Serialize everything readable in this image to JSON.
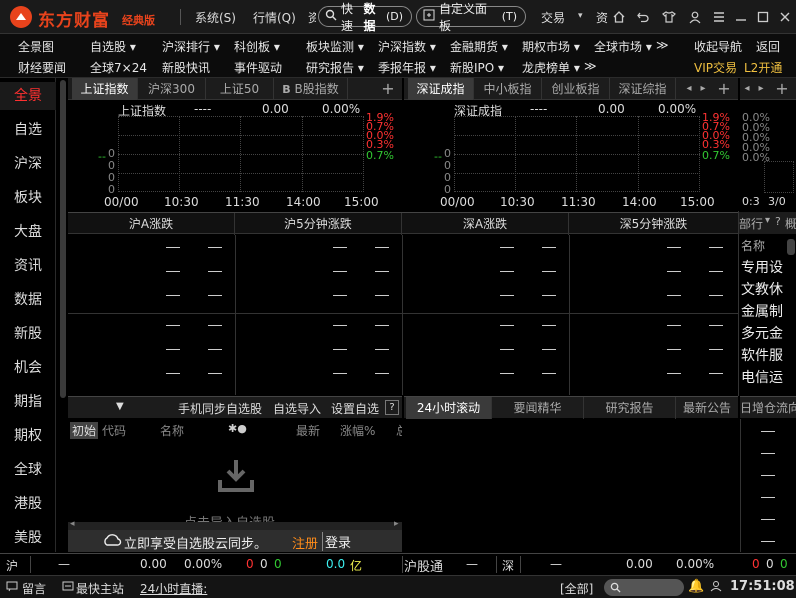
{
  "app": {
    "title": "东方财富",
    "edition": "经典版"
  },
  "topmenu": [
    "系统(S)",
    "行情(Q)",
    "交易",
    "资"
  ],
  "search_pill": {
    "prefix": "快速",
    "bold": "数据",
    "hotkey": "(D)"
  },
  "custom_pill": {
    "label": "自定义面板",
    "hotkey": "(T)"
  },
  "menu_row1": [
    "全景图",
    "自选股 ▾",
    "沪深排行 ▾",
    "科创板 ▾",
    "板块监测 ▾",
    "沪深指数 ▾",
    "金融期货 ▾",
    "期权市场 ▾",
    "全球市场 ▾",
    "≫",
    "收起导航",
    "返回"
  ],
  "menu_row2": [
    "财经要闻",
    "全球7×24",
    "新股快讯",
    "事件驱动",
    "研究报告 ▾",
    "季报年报 ▾",
    "新股IPO ▾",
    "龙虎榜单 ▾",
    "≫",
    "VIP交易",
    "L2开通"
  ],
  "leftnav": [
    "全景",
    "自选",
    "沪深",
    "板块",
    "大盘",
    "资讯",
    "数据",
    "新股",
    "机会",
    "期指",
    "期权",
    "全球",
    "港股",
    "美股"
  ],
  "panel_left": {
    "tabs": [
      "上证指数",
      "沪深300",
      "上证50",
      "B股指数"
    ],
    "name": "上证指数",
    "value": "----",
    "change": "0.00",
    "pct": "0.00%",
    "pcts_red": [
      "1.9%",
      "0.7%",
      "0.0%",
      "0.3%"
    ],
    "pct_green": "0.7%",
    "times": [
      "00/00",
      "10:30",
      "11:30",
      "14:00",
      "15:00"
    ],
    "yticks": [
      "0",
      "0",
      "0",
      "0",
      "0"
    ],
    "left_mark": "--"
  },
  "panel_right": {
    "tabs": [
      "深证成指",
      "中小板指",
      "创业板指",
      "深证综指"
    ],
    "name": "深证成指",
    "value": "----",
    "change": "0.00",
    "pct": "0.00%",
    "pcts_red": [
      "1.9%",
      "0.7%",
      "0.0%",
      "0.3%"
    ],
    "pct_green": "0.7%",
    "times": [
      "00/00",
      "10:30",
      "11:30",
      "14:00",
      "15:00"
    ],
    "yticks": [
      "0",
      "0",
      "0",
      "0",
      "0"
    ],
    "left_mark": "--"
  },
  "panel_far": {
    "pcts": [
      "0.0%",
      "0.0%",
      "0.0%",
      "0.0%",
      "0.0%"
    ],
    "time": "0:3",
    "time2": "3/0"
  },
  "table_headers": [
    "沪A涨跌",
    "沪5分钟涨跌",
    "深A涨跌",
    "深5分钟涨跌"
  ],
  "sector_panel": {
    "tab": "部行",
    "tab2": "概",
    "col": "名称",
    "items": [
      "专用设",
      "文教休",
      "金属制",
      "多元金",
      "软件服",
      "电信运"
    ]
  },
  "watchlist": {
    "toolbar": [
      "手机同步自选股",
      "自选导入",
      "设置自选",
      "?"
    ],
    "cols": [
      "初始",
      "代码",
      "名称",
      "✱●",
      "最新",
      "涨幅%",
      "总"
    ],
    "empty_hint": "点击导入自选股",
    "cloud_text": "立即享受自选股云同步。",
    "register": "注册",
    "login": "登录"
  },
  "news_tabs": [
    "24小时滚动",
    "要闻精华",
    "研究报告",
    "最新公告",
    "日增仓流向"
  ],
  "status1": {
    "sh": "沪",
    "sh_dash": "—",
    "sh_val": "0.00",
    "sh_pct": "0.00%",
    "n1": "0",
    "n2": "0",
    "n3": "0",
    "amount": "0.0",
    "amount_unit": "亿",
    "hgt": "沪股通",
    "hgt_dash": "—",
    "sz": "深",
    "sz_dash": "—",
    "sz_val": "0.00",
    "sz_pct": "0.00%",
    "m1": "0",
    "m2": "0",
    "m3": "0"
  },
  "status2": {
    "msg": "留言",
    "quick": "最快主站",
    "live": "24小时直播:",
    "all": "[全部]",
    "time": "17:51:08"
  }
}
